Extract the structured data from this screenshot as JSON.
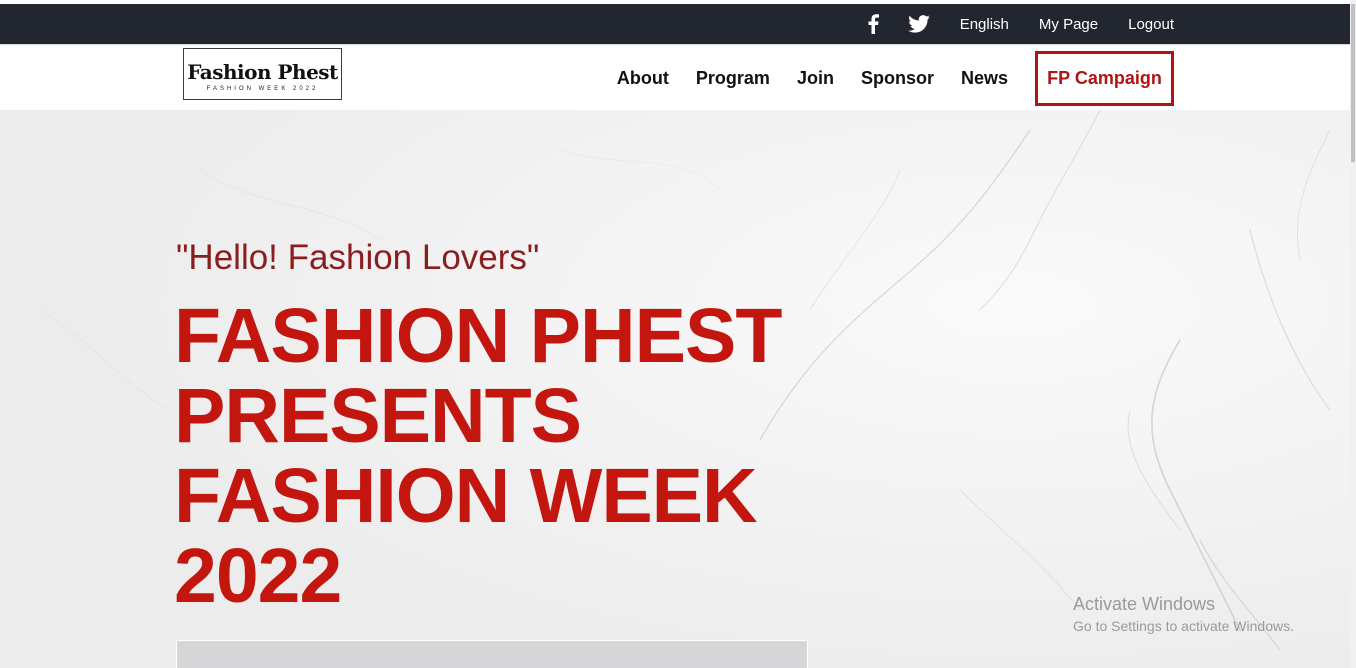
{
  "utility_bar": {
    "social": [
      {
        "icon": "facebook-icon"
      },
      {
        "icon": "twitter-icon"
      }
    ],
    "links": [
      "English",
      "My Page",
      "Logout"
    ]
  },
  "logo": {
    "title": "Fashion Phest",
    "subtitle": "FASHION WEEK 2022"
  },
  "nav": {
    "items": [
      "About",
      "Program",
      "Join",
      "Sponsor",
      "News"
    ],
    "campaign": "FP Campaign"
  },
  "hero": {
    "greeting": "\"Hello! Fashion Lovers\"",
    "headline": [
      "FASHION PHEST",
      "PRESENTS",
      "FASHION WEEK",
      "2022"
    ]
  },
  "watermark": {
    "title": "Activate Windows",
    "subtitle": "Go to Settings to activate Windows."
  },
  "colors": {
    "accent": "#c2160f",
    "greeting": "#8a1d1d",
    "topbar": "#22262f"
  }
}
